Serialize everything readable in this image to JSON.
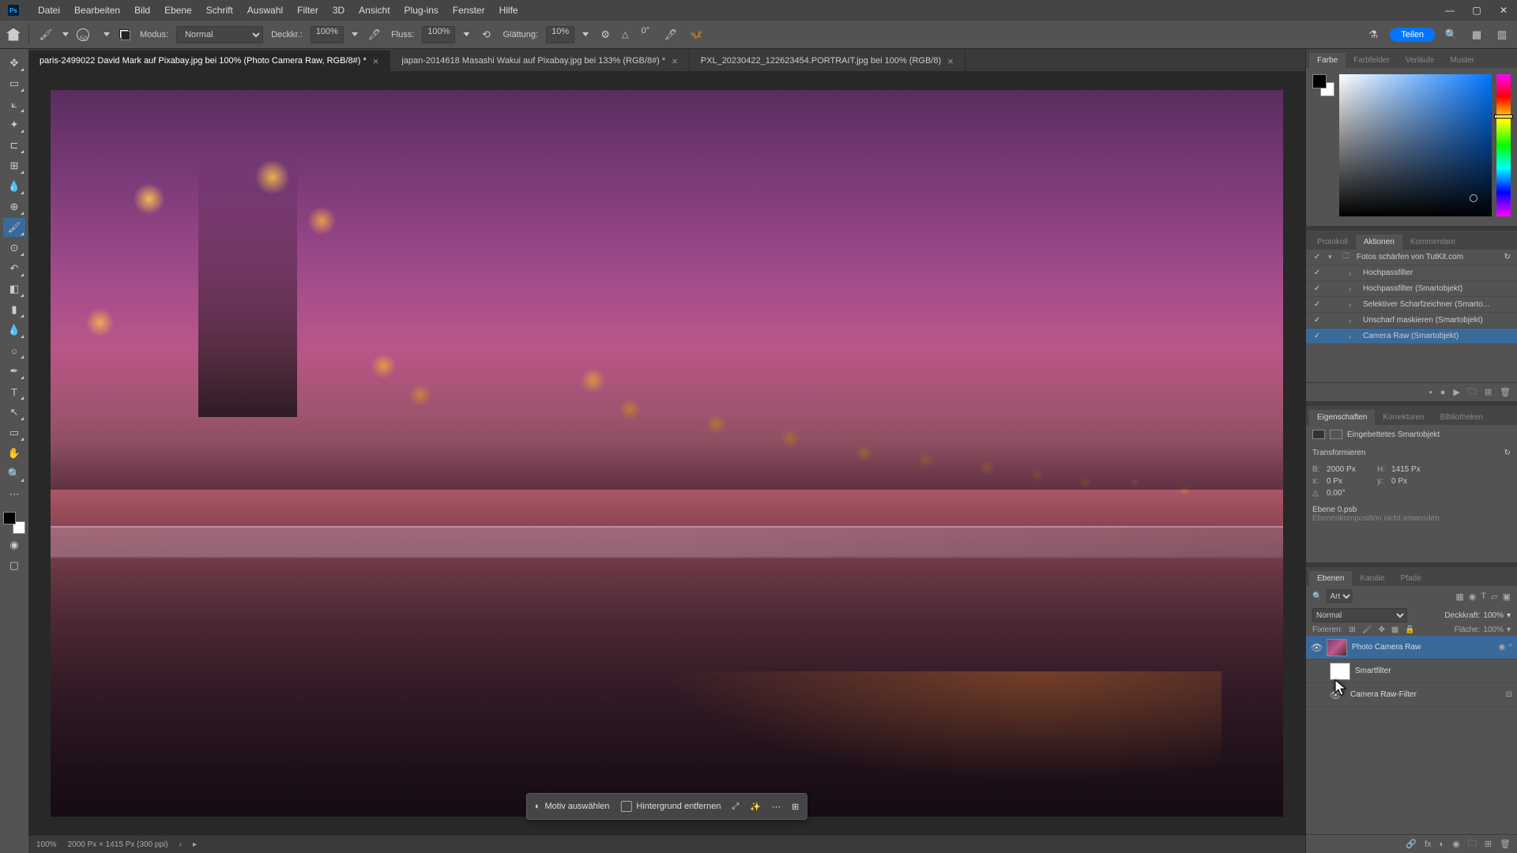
{
  "menu": [
    "Datei",
    "Bearbeiten",
    "Bild",
    "Ebene",
    "Schrift",
    "Auswahl",
    "Filter",
    "3D",
    "Ansicht",
    "Plug-ins",
    "Fenster",
    "Hilfe"
  ],
  "optbar": {
    "brush_size": "50",
    "mode_label": "Modus:",
    "mode_value": "Normal",
    "opacity_label": "Deckkr.:",
    "opacity_value": "100%",
    "flow_label": "Fluss:",
    "flow_value": "100%",
    "smooth_label": "Glättung:",
    "smooth_value": "10%",
    "angle_symbol": "△",
    "angle_value": "0°",
    "share": "Teilen"
  },
  "tabs": [
    {
      "label": "paris-2499022  David Mark auf Pixabay.jpg bei 100% (Photo Camera Raw, RGB/8#) *",
      "active": true
    },
    {
      "label": "japan-2014618 Masashi Wakui auf Pixabay.jpg bei 133% (RGB/8#) *",
      "active": false
    },
    {
      "label": "PXL_20230422_122623454.PORTRAIT.jpg bei 100% (RGB/8)",
      "active": false
    }
  ],
  "float": {
    "select_subject": "Motiv auswählen",
    "remove_bg": "Hintergrund entfernen"
  },
  "status": {
    "zoom": "100%",
    "doc": "2000 Px × 1415 Px (300 ppi)"
  },
  "color_tabs": [
    "Farbe",
    "Farbfelder",
    "Verläufe",
    "Muster"
  ],
  "actions_tabs": [
    "Protokoll",
    "Aktionen",
    "Kommentare"
  ],
  "actions": [
    {
      "label": "Fotos schärfen von TutKit.com",
      "folder": true
    },
    {
      "label": "Hochpassfilter"
    },
    {
      "label": "Hochpassfilter (Smartobjekt)"
    },
    {
      "label": "Selektiver Scharfzeichner (Smarto..."
    },
    {
      "label": "Unscharf maskieren (Smartobjekt)"
    },
    {
      "label": "Camera Raw (Smartobjekt)",
      "selected": true
    }
  ],
  "props_tabs": [
    "Eigenschaften",
    "Korrekturen",
    "Bibliotheken"
  ],
  "props": {
    "type": "Eingebettetes Smartobjekt",
    "transform": "Transformieren",
    "w_label": "B:",
    "w": "2000 Px",
    "h_label": "H:",
    "h": "1415 Px",
    "x_label": "x:",
    "x": "0 Px",
    "y_label": "y:",
    "y": "0 Px",
    "angle": "0,00°",
    "psb": "Ebene 0.psb",
    "comp": "Ebenenkomposition nicht anwenden"
  },
  "layers_tabs": [
    "Ebenen",
    "Kanäle",
    "Pfade"
  ],
  "layers": {
    "search_type": "Art",
    "blend": "Normal",
    "opacity_label": "Deckkraft:",
    "opacity": "100%",
    "lock_label": "Fixieren:",
    "fill_label": "Fläche:",
    "fill": "100%",
    "items": [
      {
        "name": "Photo Camera Raw",
        "selected": true,
        "eye": true,
        "thumb": true
      },
      {
        "name": "Smartfilter",
        "sub": true,
        "mask": true
      },
      {
        "name": "Camera Raw-Filter",
        "sub": true,
        "filter": true
      }
    ]
  }
}
